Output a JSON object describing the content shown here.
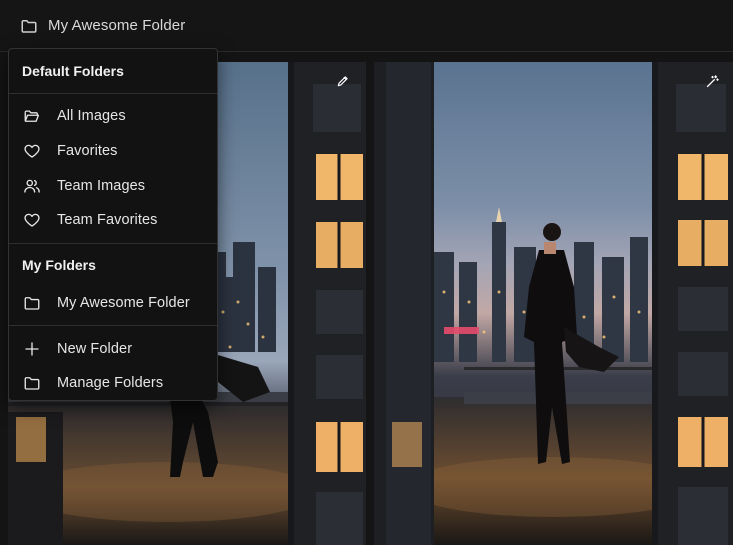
{
  "header": {
    "folder_title": "My Awesome Folder",
    "icon": "folder-icon"
  },
  "menu": {
    "default_section_title": "Default Folders",
    "default_items": [
      {
        "label": "All Images",
        "icon": "folder-open-icon"
      },
      {
        "label": "Favorites",
        "icon": "heart-icon"
      },
      {
        "label": "Team Images",
        "icon": "users-icon"
      },
      {
        "label": "Team Favorites",
        "icon": "heart-icon"
      }
    ],
    "my_section_title": "My Folders",
    "my_items": [
      {
        "label": "My Awesome Folder",
        "icon": "folder-icon"
      }
    ],
    "actions": [
      {
        "label": "New Folder",
        "icon": "plus-icon"
      },
      {
        "label": "Manage Folders",
        "icon": "folder-icon"
      }
    ]
  },
  "photos": [
    {
      "action_icon": "pencil-icon"
    },
    {
      "action_icon": "magic-wand-icon"
    }
  ],
  "colors": {
    "background": "#141414",
    "menu_background": "#121212",
    "text": "#e6e6e6"
  }
}
